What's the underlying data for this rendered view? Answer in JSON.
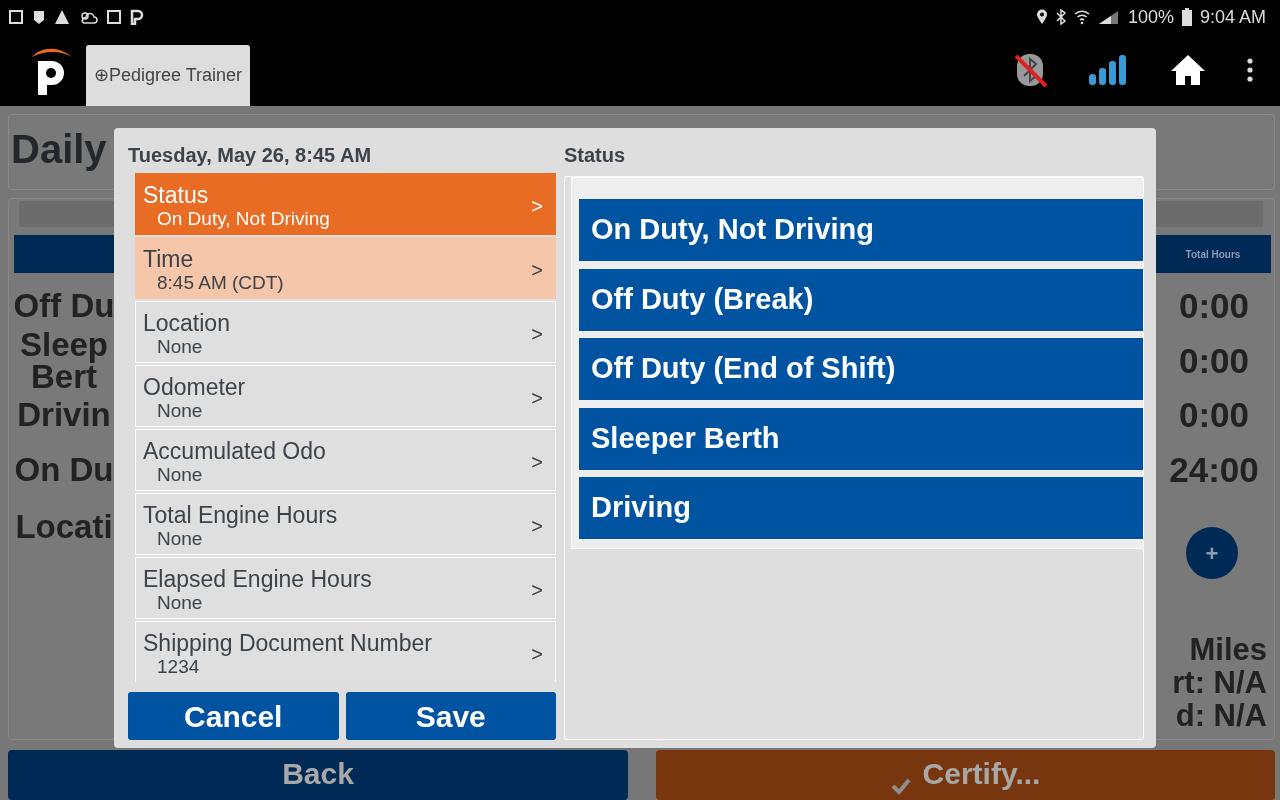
{
  "status_bar": {
    "battery": "100%",
    "time": "9:04 AM"
  },
  "app_bar": {
    "tab": "⊕Pedigree Trainer"
  },
  "background": {
    "title": "Daily",
    "table_header": "Total Hours",
    "rows": [
      {
        "label_lines": [
          "Off Du"
        ],
        "total": "0:00"
      },
      {
        "label_lines": [
          "Sleep",
          "Bert"
        ],
        "total": "0:00"
      },
      {
        "label_lines": [
          "Drivin"
        ],
        "total": "0:00"
      },
      {
        "label_lines": [
          "On Du"
        ],
        "total": "24:00"
      }
    ],
    "location_label": "Locati",
    "add_button": "+",
    "mileage_lines": [
      "Miles",
      "rt: N/A",
      "d: N/A"
    ],
    "back_button": "Back",
    "certify_button": "Certify..."
  },
  "dialog": {
    "date": "Tuesday, May 26, 8:45 AM",
    "fields": [
      {
        "label": "Status",
        "value": "On Duty, Not Driving",
        "selected": true,
        "highlighted": false,
        "chevron": ">"
      },
      {
        "label": "Time",
        "value": "8:45 AM (CDT)",
        "selected": false,
        "highlighted": true,
        "chevron": ">"
      },
      {
        "label": "Location",
        "value": "None",
        "selected": false,
        "highlighted": false,
        "chevron": ">"
      },
      {
        "label": "Odometer",
        "value": "None",
        "selected": false,
        "highlighted": false,
        "chevron": ">"
      },
      {
        "label": "Accumulated Odo",
        "value": "None",
        "selected": false,
        "highlighted": false,
        "chevron": ">"
      },
      {
        "label": "Total Engine Hours",
        "value": "None",
        "selected": false,
        "highlighted": false,
        "chevron": ">"
      },
      {
        "label": "Elapsed Engine Hours",
        "value": "None",
        "selected": false,
        "highlighted": false,
        "chevron": ">"
      },
      {
        "label": "Shipping Document Number",
        "value": "1234",
        "selected": false,
        "highlighted": false,
        "chevron": ">"
      }
    ],
    "status_title": "Status",
    "status_options": [
      "On Duty, Not Driving",
      "Off Duty (Break)",
      "Off Duty (End of Shift)",
      "Sleeper Berth",
      "Driving"
    ],
    "buttons": [
      "Cancel",
      "Save"
    ]
  }
}
